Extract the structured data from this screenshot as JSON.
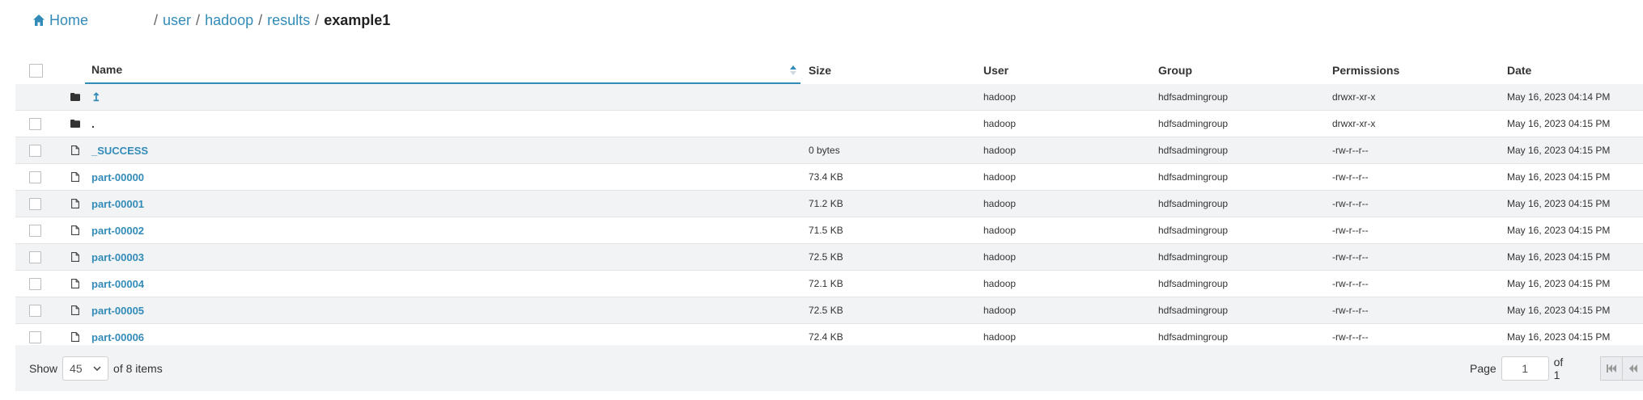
{
  "breadcrumb": {
    "home_label": "Home",
    "items": [
      "user",
      "hadoop",
      "results"
    ],
    "current": "example1",
    "separator": "/"
  },
  "table": {
    "columns": {
      "name": "Name",
      "size": "Size",
      "user": "User",
      "group": "Group",
      "permissions": "Permissions",
      "date": "Date"
    },
    "sorted_column": "Name",
    "sort_direction": "ascending",
    "rows": [
      {
        "type": "folder",
        "icon": "folder-icon",
        "name": "↥",
        "size": "",
        "user": "hadoop",
        "group": "hdfsadmingroup",
        "permissions": "drwxr-xr-x",
        "date": "May 16, 2023 04:14 PM"
      },
      {
        "type": "folder",
        "icon": "folder-icon",
        "name": ".",
        "size": "",
        "user": "hadoop",
        "group": "hdfsadmingroup",
        "permissions": "drwxr-xr-x",
        "date": "May 16, 2023 04:15 PM"
      },
      {
        "type": "file",
        "icon": "file-icon",
        "name": "_SUCCESS",
        "size": "0 bytes",
        "user": "hadoop",
        "group": "hdfsadmingroup",
        "permissions": "-rw-r--r--",
        "date": "May 16, 2023 04:15 PM"
      },
      {
        "type": "file",
        "icon": "file-icon",
        "name": "part-00000",
        "size": "73.4 KB",
        "user": "hadoop",
        "group": "hdfsadmingroup",
        "permissions": "-rw-r--r--",
        "date": "May 16, 2023 04:15 PM"
      },
      {
        "type": "file",
        "icon": "file-icon",
        "name": "part-00001",
        "size": "71.2 KB",
        "user": "hadoop",
        "group": "hdfsadmingroup",
        "permissions": "-rw-r--r--",
        "date": "May 16, 2023 04:15 PM"
      },
      {
        "type": "file",
        "icon": "file-icon",
        "name": "part-00002",
        "size": "71.5 KB",
        "user": "hadoop",
        "group": "hdfsadmingroup",
        "permissions": "-rw-r--r--",
        "date": "May 16, 2023 04:15 PM"
      },
      {
        "type": "file",
        "icon": "file-icon",
        "name": "part-00003",
        "size": "72.5 KB",
        "user": "hadoop",
        "group": "hdfsadmingroup",
        "permissions": "-rw-r--r--",
        "date": "May 16, 2023 04:15 PM"
      },
      {
        "type": "file",
        "icon": "file-icon",
        "name": "part-00004",
        "size": "72.1 KB",
        "user": "hadoop",
        "group": "hdfsadmingroup",
        "permissions": "-rw-r--r--",
        "date": "May 16, 2023 04:15 PM"
      },
      {
        "type": "file",
        "icon": "file-icon",
        "name": "part-00005",
        "size": "72.5 KB",
        "user": "hadoop",
        "group": "hdfsadmingroup",
        "permissions": "-rw-r--r--",
        "date": "May 16, 2023 04:15 PM"
      },
      {
        "type": "file",
        "icon": "file-icon",
        "name": "part-00006",
        "size": "72.4 KB",
        "user": "hadoop",
        "group": "hdfsadmingroup",
        "permissions": "-rw-r--r--",
        "date": "May 16, 2023 04:15 PM"
      }
    ]
  },
  "footer": {
    "show_label": "Show",
    "page_size": "45",
    "items_label": "of 8 items",
    "page_label": "Page",
    "page_value": "1",
    "of_pages": "of 1"
  },
  "colors": {
    "accent": "#338bb8",
    "row_alt": "#f1f3f5",
    "footer_bg": "#f1f3f5"
  }
}
